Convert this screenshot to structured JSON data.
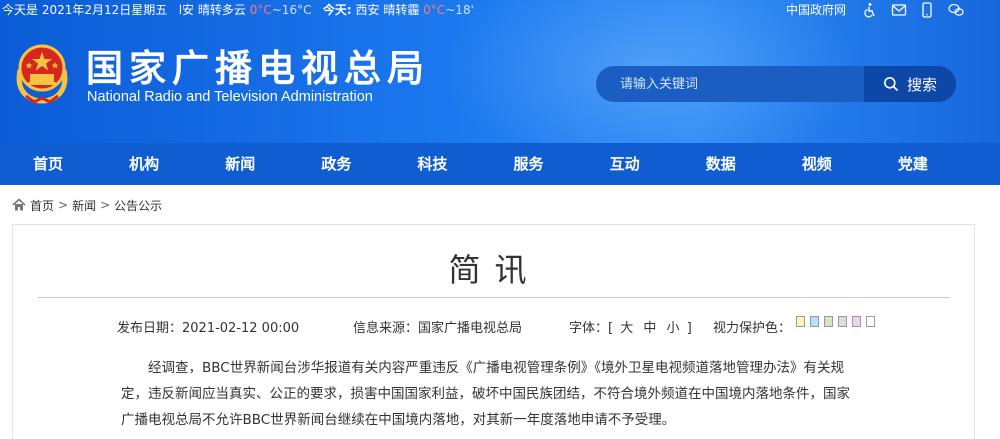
{
  "topbar": {
    "weather_today_prefix": "今天是 2021年2月12日星期五",
    "weather_city1_trunc": "l安",
    "weather_cond1": "晴转多云",
    "weather_hi1": "0°C",
    "weather_lo1": "~16°C",
    "weather_today2_label": "今天:",
    "weather_city2": "西安",
    "weather_cond2": "晴转霾",
    "weather_hi2": "0°C",
    "weather_lo2": "~18'",
    "gov_link": "中国政府网",
    "icons": [
      "accessibility-icon",
      "mail-icon",
      "mobile-icon",
      "wechat-icon"
    ]
  },
  "header": {
    "title_cn": "国家广播电视总局",
    "title_en": "National Radio and Television Administration",
    "search_placeholder": "请输入关键词",
    "search_button": "搜索",
    "colors": {
      "brand_blue": "#0f5dd1",
      "search_btn": "#0d47a8"
    }
  },
  "nav": {
    "items": [
      "首页",
      "机构",
      "新闻",
      "政务",
      "科技",
      "服务",
      "互动",
      "数据",
      "视频",
      "党建"
    ]
  },
  "breadcrumb": {
    "items": [
      "首页",
      "新闻",
      "公告公示"
    ],
    "separator": ">"
  },
  "article": {
    "title": "简讯",
    "publish_date": "发布日期：2021-02-12 00:00",
    "source": "信息来源：国家广播电视总局",
    "font_size_label": "字体：[",
    "font_sizes": [
      "大",
      "中",
      "小"
    ],
    "font_size_close": "]",
    "eye_care_label": "视力保护色：",
    "eye_care_colors": [
      "#fbf6b0",
      "#b7e2f6",
      "#d6e6c5",
      "#dcdcdc",
      "#ecd3f0",
      "#ffffff"
    ],
    "body": "经调查，BBC世界新闻台涉华报道有关内容严重违反《广播电视管理条例》《境外卫星电视频道落地管理办法》有关规定，违反新闻应当真实、公正的要求，损害中国国家利益，破坏中国民族团结，不符合境外频道在中国境内落地条件，国家广播电视总局不允许BBC世界新闻台继续在中国境内落地，对其新一年度落地申请不予受理。"
  }
}
